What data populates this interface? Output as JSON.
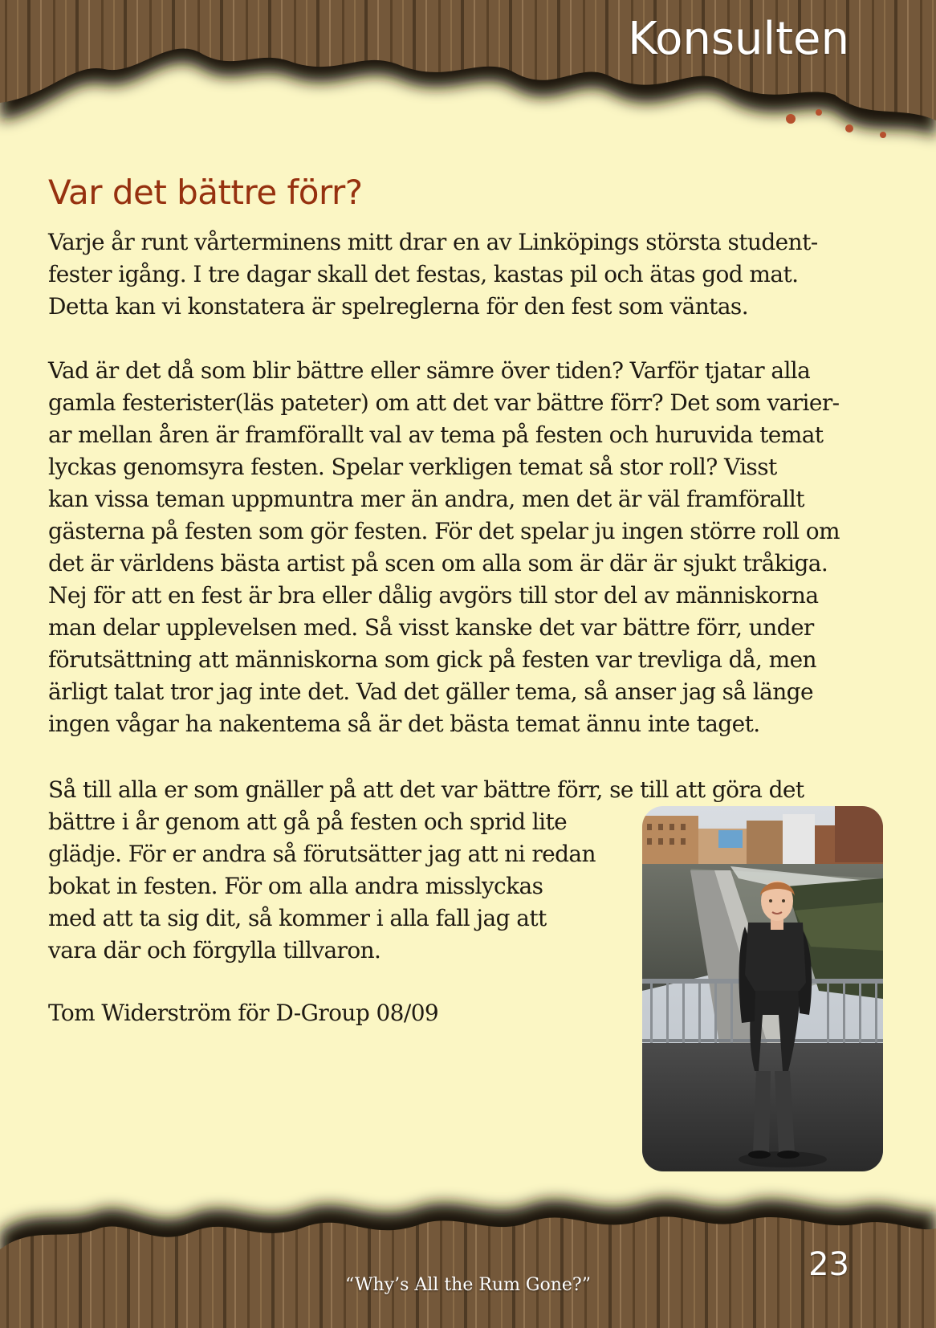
{
  "header": {
    "section_title": "Konsulten"
  },
  "article": {
    "title": "Var det bättre förr?",
    "paragraphs": [
      "Varje år runt vårterminens mitt drar en av Linköpings största student-\nfester igång. I tre dagar skall det festas, kastas pil och ätas god mat.\nDetta kan vi konstatera är spelreglerna för den fest som väntas.",
      "Vad är det då som blir bättre eller sämre över tiden? Varför tjatar alla\ngamla festeristerläs pateter) om att det var bättre förr? Det som varier-\nar mellan åren är framförallt val av tema på festen och huruvida temat\nlyckas genomsyra festen. Spelar verkligen temat så stor roll? Visst\nkan vissa teman uppmuntra mer än andra, men det är väl framförallt\ngästerna på festen som gör festen. För det spelar ju ingen större roll om\ndet är världens bästa artist på scen om alla som är där är sjukt tråkiga.\nNej för att en fest är bra eller dålig avgörs till stor del av människorna\nman delar upplevelsen med. Så visst kanske det var bättre förr, under\nförutsättning att människorna som gick på festen var trevliga då, men\närligt talat tror jag inte det. Vad det gäller tema, så anser jag så länge\ningen vågar ha nakentema så är det bästa temat ännu inte taget.",
      "Så till alla er som gnäller på att det var bättre förr, se till att göra det",
      "bättre i år genom att gå på festen och sprid lite\nglädje. För er andra så förutsätter jag att ni redan\nbokat in festen. För om alla andra misslyckas\nmed att ta sig dit, så kommer i alla fall jag att\nvara där och förgylla tillvaron."
    ],
    "signature": "Tom Widerström för D-Group 08/09"
  },
  "footer": {
    "page_number": "23",
    "quote": "“Why’s All the Rum Gone?”"
  },
  "colors": {
    "background": "#fbf6c4",
    "title": "#96310f",
    "wood": "#6b5233",
    "text": "#1f1a12"
  },
  "icons": {
    "photo": "portrait-photo"
  }
}
